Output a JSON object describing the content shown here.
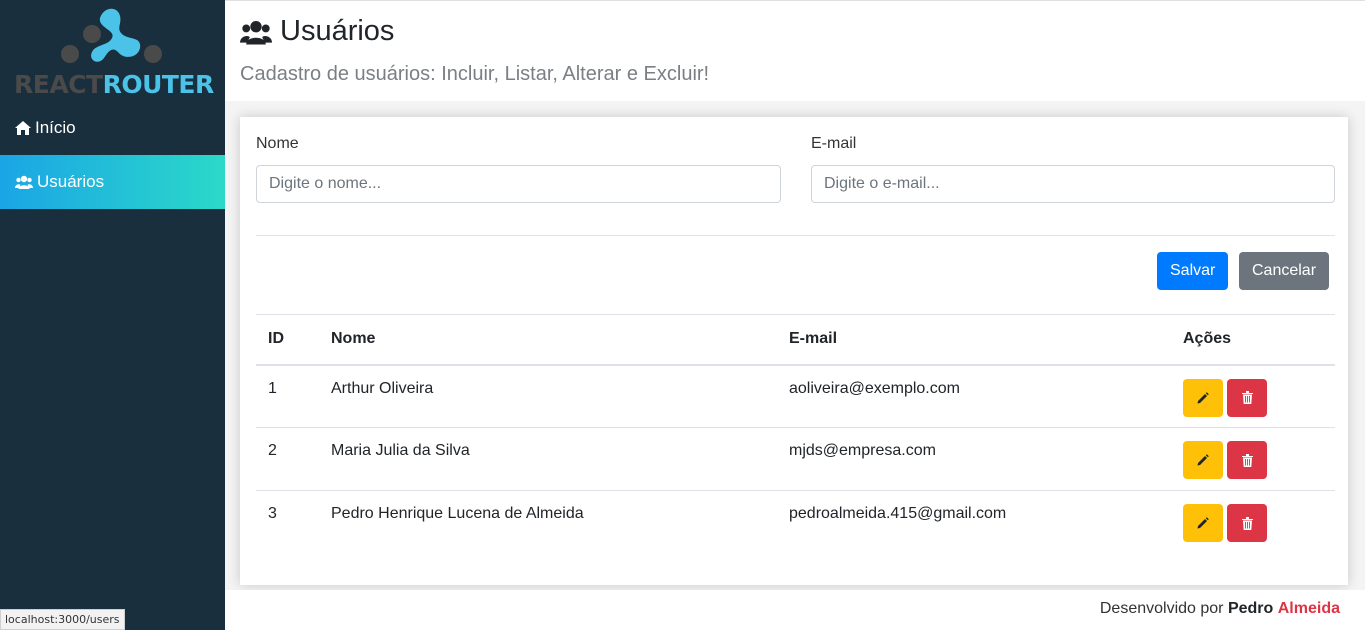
{
  "sidebar": {
    "logo": {
      "word1": "REACT",
      "word2": "ROUTER"
    },
    "items": [
      {
        "label": "Início",
        "icon": "home-icon",
        "active": false
      },
      {
        "label": "Usuários",
        "icon": "users-icon",
        "active": true
      }
    ]
  },
  "header": {
    "title": "Usuários",
    "subtitle": "Cadastro de usuários: Incluir, Listar, Alterar e Excluir!"
  },
  "form": {
    "name_label": "Nome",
    "name_placeholder": "Digite o nome...",
    "name_value": "",
    "email_label": "E-mail",
    "email_placeholder": "Digite o e-mail...",
    "email_value": "",
    "save_label": "Salvar",
    "cancel_label": "Cancelar"
  },
  "table": {
    "headers": {
      "id": "ID",
      "name": "Nome",
      "email": "E-mail",
      "actions": "Ações"
    },
    "rows": [
      {
        "id": "1",
        "name": "Arthur Oliveira",
        "email": "aoliveira@exemplo.com"
      },
      {
        "id": "2",
        "name": "Maria Julia da Silva",
        "email": "mjds@empresa.com"
      },
      {
        "id": "3",
        "name": "Pedro Henrique Lucena de Almeida",
        "email": "pedroalmeida.415@gmail.com"
      }
    ]
  },
  "footer": {
    "prefix": "Desenvolvido por",
    "first_name": "Pedro",
    "last_name": "Almeida"
  },
  "status_url": "localhost:3000/users",
  "colors": {
    "sidebar_bg": "#1a2f3d",
    "active_gradient_start": "#1aa5e6",
    "active_gradient_end": "#2bd9c8",
    "primary": "#007bff",
    "secondary": "#6c757d",
    "warning": "#ffc107",
    "danger": "#dc3545"
  }
}
